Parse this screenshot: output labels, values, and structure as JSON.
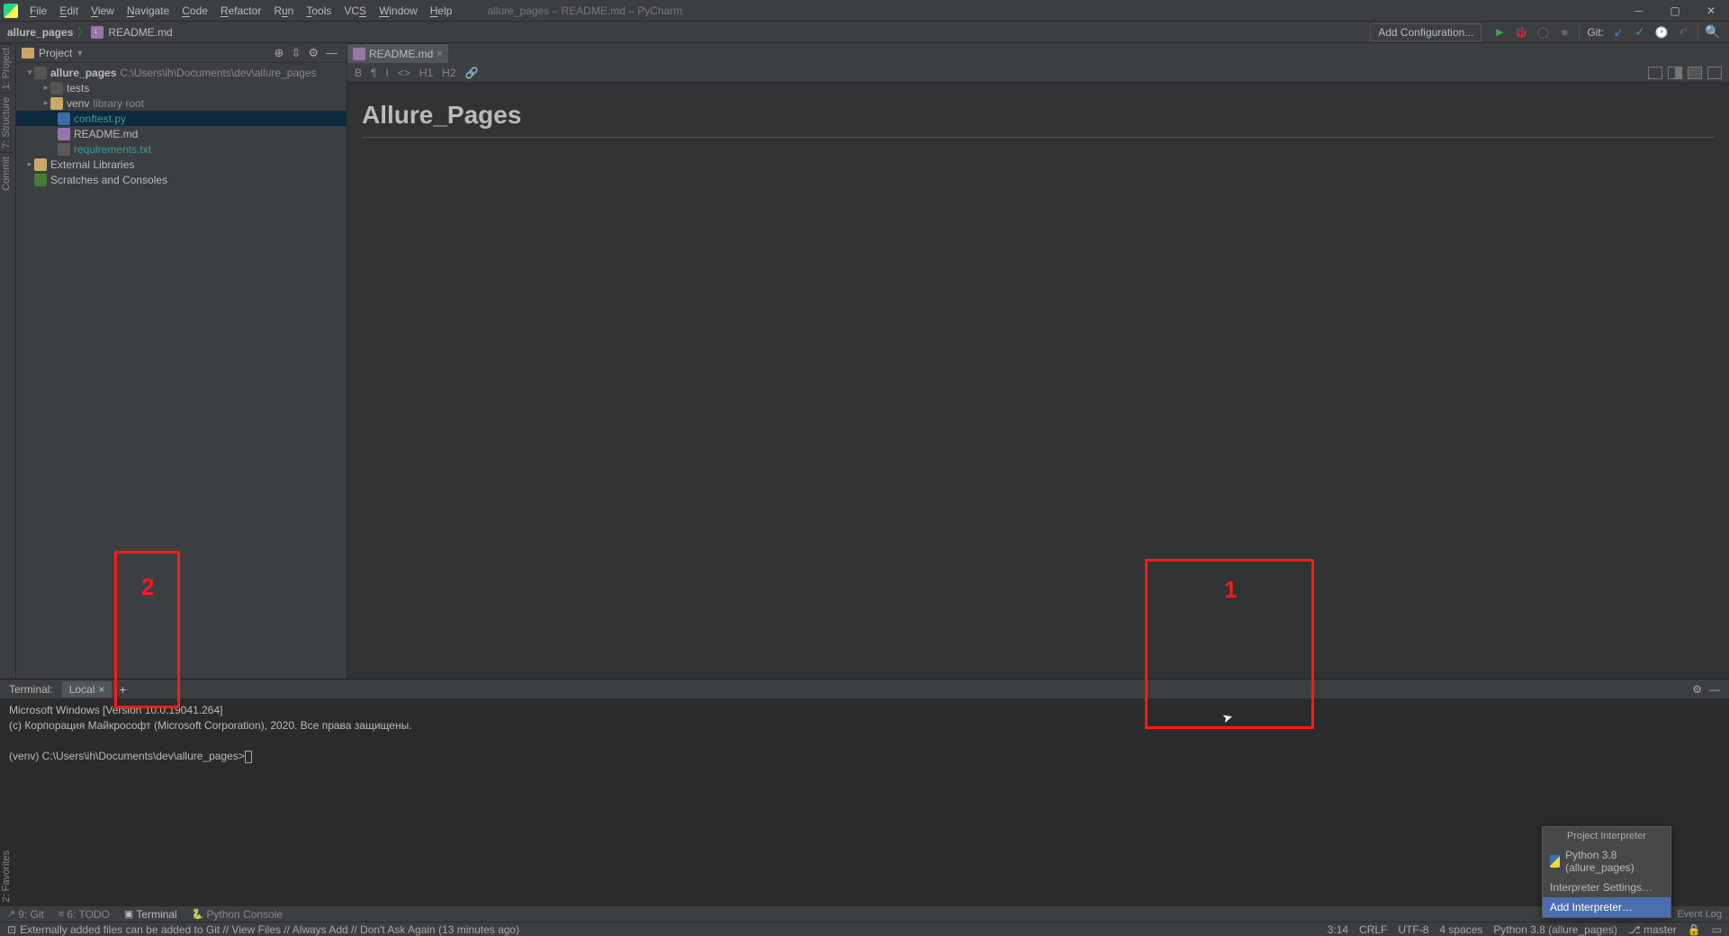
{
  "menubar": {
    "items": [
      "File",
      "Edit",
      "View",
      "Navigate",
      "Code",
      "Refactor",
      "Run",
      "Tools",
      "VCS",
      "Window",
      "Help"
    ],
    "title": "allure_pages – README.md – PyCharm"
  },
  "breadcrumbs": {
    "root": "allure_pages",
    "file": "README.md"
  },
  "navbar": {
    "addConfig": "Add Configuration...",
    "git": "Git:"
  },
  "project_panel": {
    "label": "Project",
    "tree": {
      "root": {
        "name": "allure_pages",
        "path": "C:\\Users\\ih\\Documents\\dev\\allure_pages"
      },
      "tests": "tests",
      "venv": {
        "name": "venv",
        "tag": "library root"
      },
      "conftest": "conftest.py",
      "readme": "README.md",
      "requirements": "requirements.txt",
      "external": "External Libraries",
      "scratches": "Scratches and Consoles"
    }
  },
  "left_sidebar": {
    "project": "1: Project",
    "structure": "7: Structure",
    "commit": "Commit",
    "favorites": "2: Favorites"
  },
  "editor": {
    "tab": "README.md",
    "heading": "Allure_Pages"
  },
  "md_toolbar": {
    "b": "B",
    "p": "¶",
    "i": "I",
    "code": "<>",
    "h1": "H1",
    "h2": "H2",
    "link": "🔗"
  },
  "terminal": {
    "label": "Terminal:",
    "tab": "Local",
    "line1": "Microsoft Windows [Version 10.0.19041.264]",
    "line2": "(c) Корпорация Майкрософт (Microsoft Corporation), 2020. Все права защищены.",
    "prompt": "(venv) C:\\Users\\ih\\Documents\\dev\\allure_pages>"
  },
  "bottom_tools": {
    "git": "9: Git",
    "todo": "6: TODO",
    "terminal": "Terminal",
    "pyconsole": "Python Console",
    "eventlog": "Event Log"
  },
  "status_bar": {
    "msg": "Externally added files can be added to Git // View Files // Always Add // Don't Ask Again (13 minutes ago)",
    "pos": "3:14",
    "lineend": "CRLF",
    "enc": "UTF-8",
    "indent": "4 spaces",
    "interp": "Python 3.8 (allure_pages)",
    "branch": "master"
  },
  "popup": {
    "title": "Project Interpreter",
    "current": "Python 3.8 (allure_pages)",
    "settings": "Interpreter Settings…",
    "add": "Add Interpreter…"
  },
  "annotations": {
    "box1": "1",
    "box2": "2"
  }
}
